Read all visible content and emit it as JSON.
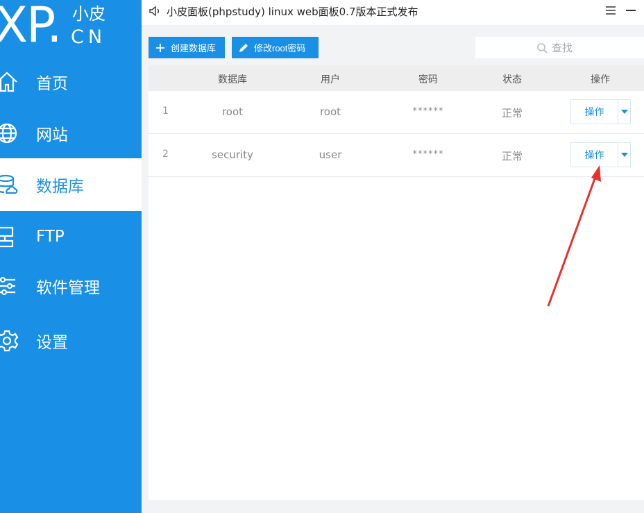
{
  "logo": {
    "big": "XP.",
    "cn_top": "小皮",
    "cn_bottom": "CN"
  },
  "sidebar": {
    "items": [
      {
        "label": "首页",
        "icon": "home-icon"
      },
      {
        "label": "网站",
        "icon": "globe-icon"
      },
      {
        "label": "数据库",
        "icon": "database-icon"
      },
      {
        "label": "FTP",
        "icon": "ftp-icon"
      },
      {
        "label": "软件管理",
        "icon": "sliders-icon"
      },
      {
        "label": "设置",
        "icon": "gear-icon"
      }
    ],
    "active_index": 2
  },
  "titlebar": {
    "title": "小皮面板(phpstudy) linux web面板0.7版本正式发布"
  },
  "toolbar": {
    "create_label": "创建数据库",
    "modify_label": "修改root密码",
    "search_placeholder": "查找"
  },
  "table": {
    "headers": [
      "数据库",
      "用户",
      "密码",
      "状态",
      "操作"
    ],
    "rows": [
      {
        "index": "1",
        "database": "root",
        "user": "root",
        "password": "******",
        "status": "正常",
        "action": "操作"
      },
      {
        "index": "2",
        "database": "security",
        "user": "user",
        "password": "******",
        "status": "正常",
        "action": "操作"
      }
    ]
  },
  "colors": {
    "accent": "#1a8fe6",
    "annotation_arrow": "#e8312c"
  }
}
